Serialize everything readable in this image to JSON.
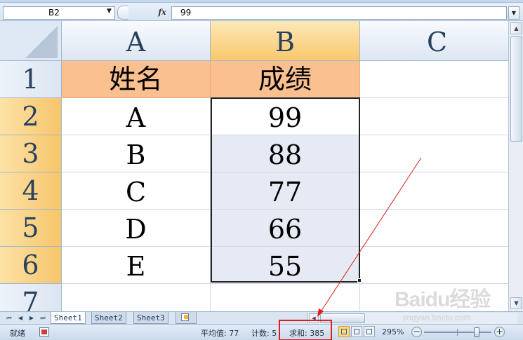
{
  "formula_bar": {
    "name_box": "B2",
    "fx_label": "fx",
    "formula": "99"
  },
  "columns": [
    {
      "label": "A",
      "selected": false
    },
    {
      "label": "B",
      "selected": true
    },
    {
      "label": "C",
      "selected": false
    }
  ],
  "rows": [
    {
      "label": "1",
      "selected": false
    },
    {
      "label": "2",
      "selected": true
    },
    {
      "label": "3",
      "selected": true
    },
    {
      "label": "4",
      "selected": true
    },
    {
      "label": "5",
      "selected": true
    },
    {
      "label": "6",
      "selected": true
    },
    {
      "label": "7",
      "selected": false
    }
  ],
  "cells": {
    "A1": "姓名",
    "B1": "成绩",
    "A2": "A",
    "B2": "99",
    "A3": "B",
    "B3": "88",
    "A4": "C",
    "B4": "77",
    "A5": "D",
    "B5": "66",
    "A6": "E",
    "B6": "55"
  },
  "sheet_tabs": [
    {
      "label": "Sheet1",
      "active": true
    },
    {
      "label": "Sheet2",
      "active": false
    },
    {
      "label": "Sheet3",
      "active": false
    }
  ],
  "status_bar": {
    "ready": "就绪",
    "average": "平均值: 77",
    "count": "计数: 5",
    "sum": "求和: 385",
    "zoom": "295%",
    "zoom_out_label": "−",
    "zoom_in_label": "+"
  },
  "watermark": {
    "logo": "Baidu经验",
    "site": "jingyan.baidu.com"
  },
  "colors": {
    "header_fill": "#fac090",
    "selection_fill": "#e6eaf4",
    "annotation": "#e31b1b"
  }
}
